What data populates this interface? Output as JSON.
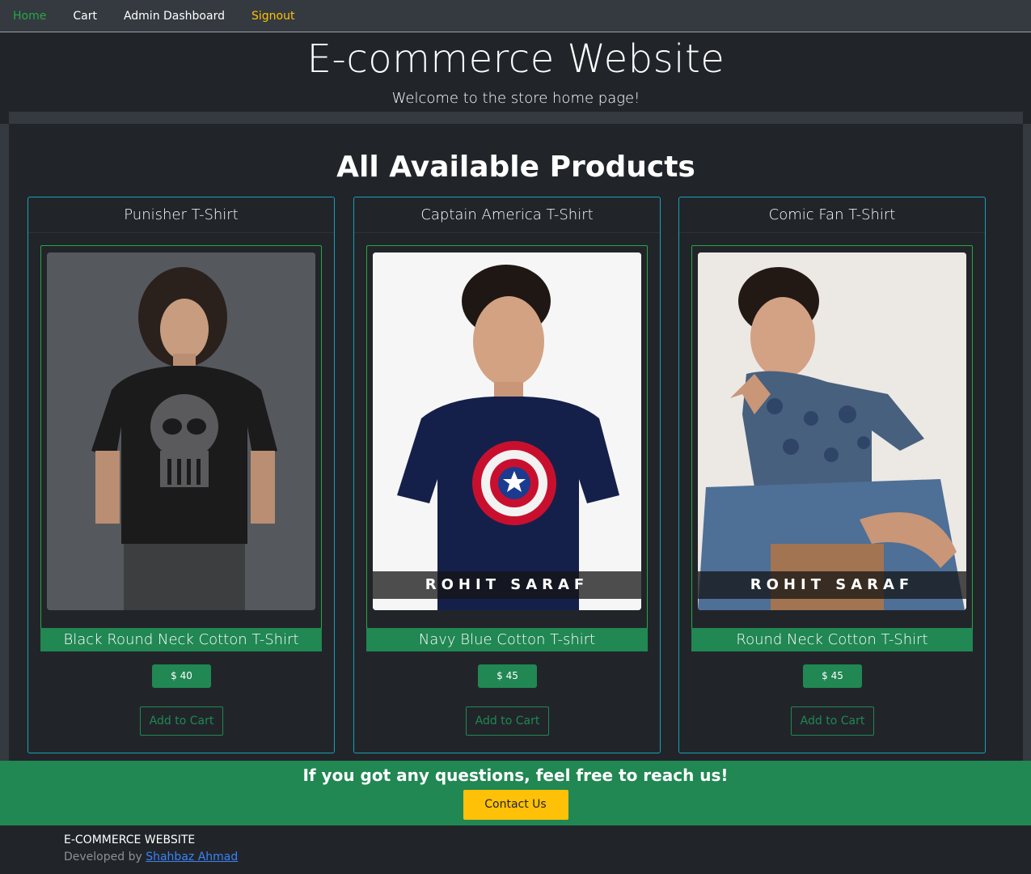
{
  "nav": {
    "home": "Home",
    "cart": "Cart",
    "admin": "Admin Dashboard",
    "signout": "Signout"
  },
  "hero": {
    "title": "E-commerce Website",
    "subtitle": "Welcome to the store home page!"
  },
  "main": {
    "title": "All Available Products"
  },
  "products": [
    {
      "name": "Punisher T-Shirt",
      "caption": "Black Round Neck Cotton T-Shirt",
      "price": "$ 40",
      "button": "Add to Cart",
      "image": "punisher-tshirt-photo",
      "brand": ""
    },
    {
      "name": "Captain America T-Shirt",
      "caption": "Navy Blue Cotton T-shirt",
      "price": "$ 45",
      "button": "Add to Cart",
      "image": "captain-america-tshirt-photo",
      "brand": "ROHIT SARAF"
    },
    {
      "name": "Comic Fan T-Shirt",
      "caption": "Round Neck Cotton T-Shirt",
      "price": "$ 45",
      "button": "Add to Cart",
      "image": "comic-fan-tshirt-photo",
      "brand": "ROHIT SARAF"
    }
  ],
  "contact": {
    "text": "If you got any questions, feel free to reach us!",
    "button": "Contact Us"
  },
  "footer": {
    "title": "E-COMMERCE WEBSITE",
    "dev_prefix": "Developed by ",
    "dev_name": "Shahbaz Ahmad"
  },
  "colors": {
    "success": "#218753",
    "info": "#17a2b8",
    "warning": "#ffc107",
    "dark": "#212529"
  }
}
